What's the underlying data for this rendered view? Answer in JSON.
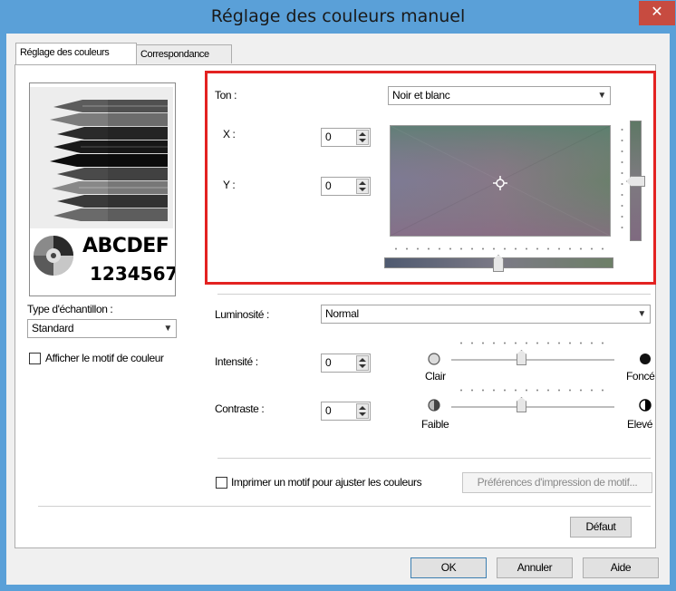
{
  "window": {
    "title": "Réglage des couleurs manuel",
    "close_glyph": "✕"
  },
  "tabs": [
    {
      "label": "Réglage des couleurs",
      "active": true
    },
    {
      "label": "Correspondance",
      "active": false
    }
  ],
  "preview": {
    "sample_text_1": "ABCDEF",
    "sample_text_2": "1234567"
  },
  "sample_type": {
    "label": "Type d'échantillon :",
    "value": "Standard"
  },
  "show_pattern": {
    "label": "Afficher le motif de couleur",
    "checked": false
  },
  "tone": {
    "label": "Ton :",
    "value": "Noir et blanc"
  },
  "x_field": {
    "label": "X :",
    "value": "0"
  },
  "y_field": {
    "label": "Y :",
    "value": "0"
  },
  "brightness": {
    "label": "Luminosité :",
    "value": "Normal"
  },
  "intensity": {
    "label": "Intensité :",
    "value": "0",
    "low": "Clair",
    "high": "Foncé",
    "level": 0.5
  },
  "contrast": {
    "label": "Contraste :",
    "value": "0",
    "low": "Faible",
    "high": "Elevé",
    "level": 0.5
  },
  "print_pattern": {
    "label": "Imprimer un motif pour ajuster les couleurs",
    "checked": false,
    "prefs_button": "Préférences d'impression de motif..."
  },
  "buttons": {
    "default": "Défaut",
    "ok": "OK",
    "cancel": "Annuler",
    "help": "Aide"
  },
  "colors": {
    "titlebar": "#5aa0d8",
    "close": "#c74b40",
    "highlight": "#e32221"
  }
}
